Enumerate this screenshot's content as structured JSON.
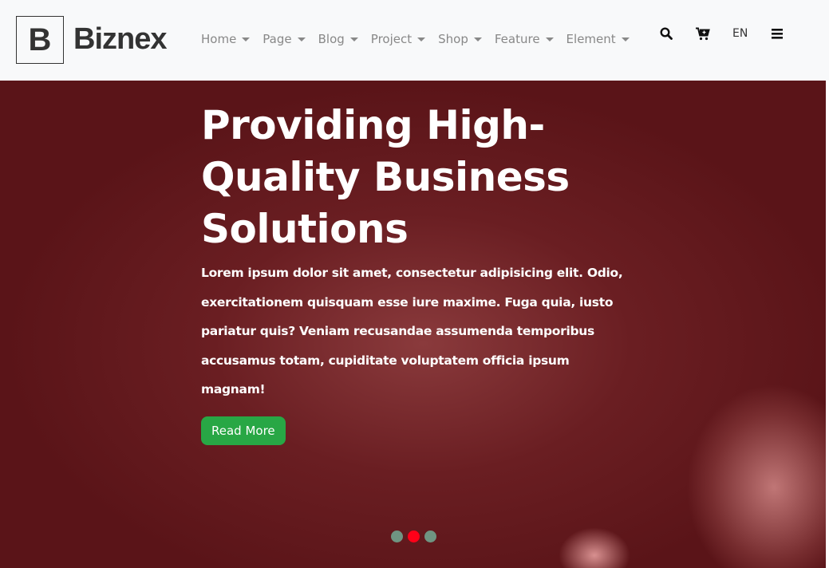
{
  "brand": {
    "logo_letter": "B",
    "name": "Biznex"
  },
  "nav": {
    "items": [
      {
        "label": "Home"
      },
      {
        "label": "Page"
      },
      {
        "label": "Blog"
      },
      {
        "label": "Project"
      },
      {
        "label": "Shop"
      },
      {
        "label": "Feature"
      },
      {
        "label": "Element"
      }
    ],
    "language": "EN",
    "icons": [
      "search-icon",
      "cart-plus-icon",
      "hamburger-menu-icon"
    ]
  },
  "hero": {
    "title": "Providing High-Quality Business Solutions",
    "description": "Lorem ipsum dolor sit amet, consectetur adipisicing elit. Odio, exercitationem quisquam esse iure maxime. Fuga quia, iusto pariatur quis? Veniam recusandae assumenda temporibus accusamus totam, cupiditate voluptatem officia ipsum magnam!",
    "button": "Read More",
    "slides": 3,
    "active_slide": 2
  },
  "colors": {
    "accent_button": "#28a745",
    "overlay": "#5e1519",
    "active_dot": "#ff0018",
    "inactive_dot": "#6f9582"
  }
}
